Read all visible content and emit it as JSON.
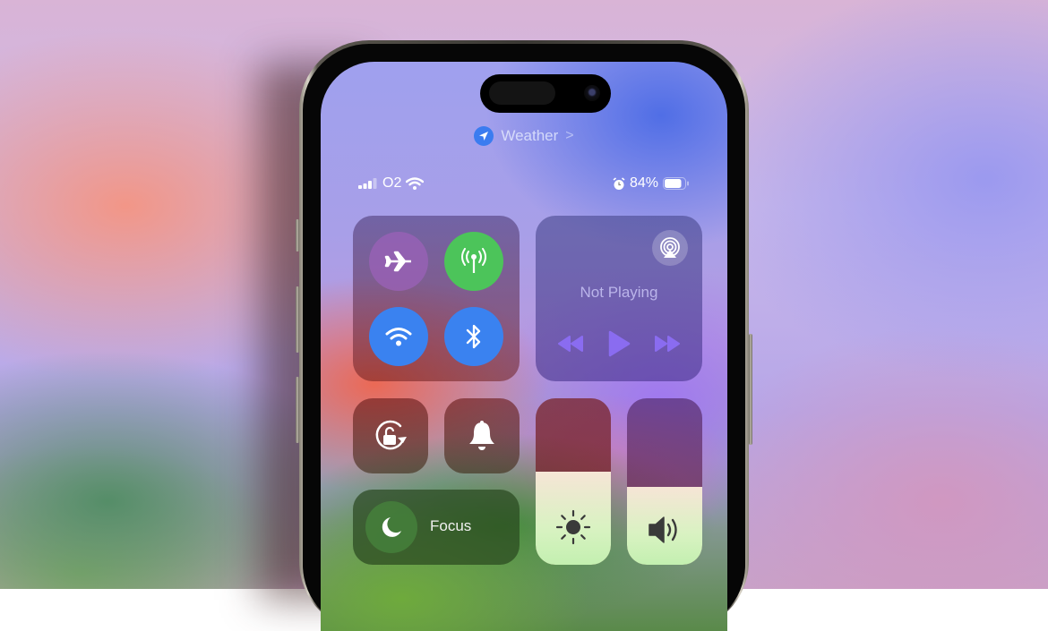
{
  "dynamic_island_app": {
    "label": "Weather",
    "icon": "location-arrow-icon",
    "chevron": ">"
  },
  "status_bar": {
    "signal_icon": "cellular-signal-icon",
    "carrier": "O2",
    "wifi_icon": "wifi-icon",
    "alarm_icon": "alarm-clock-icon",
    "battery_percent": "84%",
    "battery_level": 0.84
  },
  "connectivity": {
    "airplane_mode": {
      "icon": "airplane-icon",
      "on": false,
      "color": "#9b62b8"
    },
    "cellular_data": {
      "icon": "antenna-icon",
      "on": true,
      "color": "#4cc45a"
    },
    "wifi": {
      "icon": "wifi-icon",
      "on": true,
      "color": "#3a82f0"
    },
    "bluetooth": {
      "icon": "bluetooth-icon",
      "on": true,
      "color": "#3a82f0"
    }
  },
  "media": {
    "status": "Not Playing",
    "airplay_icon": "airplay-icon",
    "controls": [
      "rewind-icon",
      "play-icon",
      "fast-forward-icon"
    ],
    "accent": "#8a6cf0"
  },
  "toggles": {
    "rotation_lock": {
      "icon": "rotation-lock-icon"
    },
    "silent_mode": {
      "icon": "bell-icon"
    }
  },
  "focus": {
    "label": "Focus",
    "icon": "moon-icon"
  },
  "sliders": {
    "brightness": {
      "icon": "sun-icon",
      "level": 0.56
    },
    "volume": {
      "icon": "speaker-icon",
      "level": 0.47
    }
  }
}
